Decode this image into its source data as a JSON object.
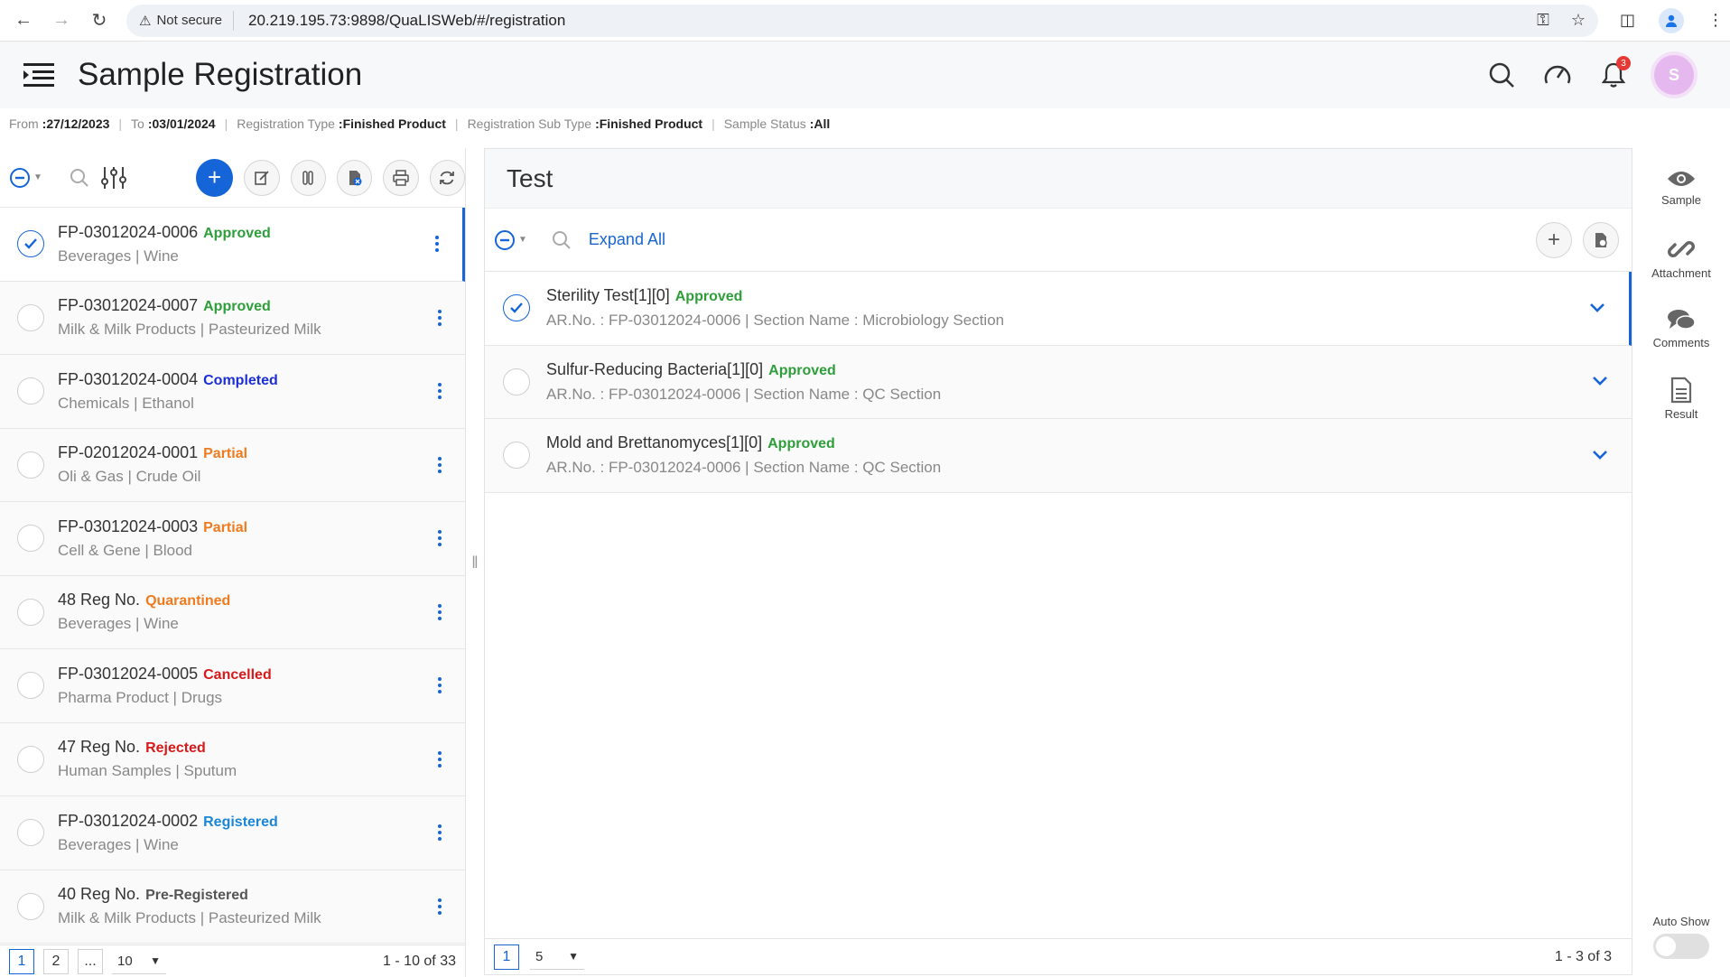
{
  "browser": {
    "not_secure": "Not secure",
    "url": "20.219.195.73:9898/QuaLISWeb/#/registration"
  },
  "header": {
    "title": "Sample Registration",
    "notification_count": "3",
    "avatar_initial": "S"
  },
  "filters": {
    "from_label": "From",
    "from_value": ":27/12/2023",
    "to_label": "To",
    "to_value": ":03/01/2024",
    "reg_type_label": "Registration Type",
    "reg_type_value": ":Finished Product",
    "reg_subtype_label": "Registration Sub Type",
    "reg_subtype_value": ":Finished Product",
    "status_label": "Sample Status",
    "status_value": ":All"
  },
  "samples": [
    {
      "id": "FP-03012024-0006",
      "status": "Approved",
      "status_color": "#2e9e3a",
      "sub": "Beverages | Wine",
      "selected": true
    },
    {
      "id": "FP-03012024-0007",
      "status": "Approved",
      "status_color": "#2e9e3a",
      "sub": "Milk & Milk Products | Pasteurized Milk"
    },
    {
      "id": "FP-03012024-0004",
      "status": "Completed",
      "status_color": "#1c2fd6",
      "sub": "Chemicals | Ethanol"
    },
    {
      "id": "FP-02012024-0001",
      "status": "Partial",
      "status_color": "#f07a1e",
      "sub": "Oli & Gas | Crude Oil"
    },
    {
      "id": "FP-03012024-0003",
      "status": "Partial",
      "status_color": "#f07a1e",
      "sub": "Cell & Gene | Blood"
    },
    {
      "id": "48 Reg No.",
      "status": "Quarantined",
      "status_color": "#f07a1e",
      "sub": "Beverages | Wine"
    },
    {
      "id": "FP-03012024-0005",
      "status": "Cancelled",
      "status_color": "#d61a1a",
      "sub": "Pharma Product | Drugs"
    },
    {
      "id": "47 Reg No.",
      "status": "Rejected",
      "status_color": "#d61a1a",
      "sub": "Human Samples | Sputum"
    },
    {
      "id": "FP-03012024-0002",
      "status": "Registered",
      "status_color": "#1a86d6",
      "sub": "Beverages | Wine"
    },
    {
      "id": "40 Reg No.",
      "status": "Pre-Registered",
      "status_color": "#555555",
      "sub": "Milk & Milk Products | Pasteurized Milk"
    }
  ],
  "left_pager": {
    "pages": [
      "1",
      "2",
      "..."
    ],
    "page_size": "10",
    "count": "1 - 10 of 33"
  },
  "test_panel": {
    "title": "Test",
    "expand_all": "Expand All",
    "tests": [
      {
        "name": "Sterility Test[1][0]",
        "status": "Approved",
        "sub": "AR.No. : FP-03012024-0006 | Section Name : Microbiology Section",
        "selected": true
      },
      {
        "name": "Sulfur-Reducing Bacteria[1][0]",
        "status": "Approved",
        "sub": "AR.No. : FP-03012024-0006 | Section Name : QC Section"
      },
      {
        "name": "Mold and Brettanomyces[1][0]",
        "status": "Approved",
        "sub": "AR.No. : FP-03012024-0006 | Section Name : QC Section"
      }
    ],
    "pager": {
      "page": "1",
      "page_size": "5",
      "count": "1 - 3 of 3"
    }
  },
  "rail": {
    "sample": "Sample",
    "attachment": "Attachment",
    "comments": "Comments",
    "result": "Result",
    "auto_show": "Auto Show"
  },
  "colors": {
    "accent": "#1565d8",
    "approved": "#2e9e3a"
  }
}
